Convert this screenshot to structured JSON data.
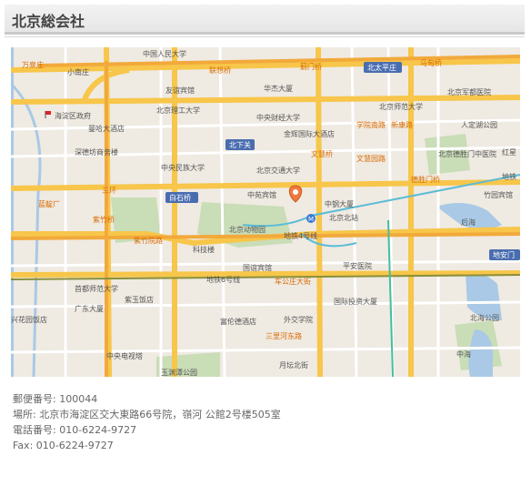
{
  "header": {
    "title": "北京総会社"
  },
  "map": {
    "labels": [
      {
        "id": "l1",
        "text": "万泉庄"
      },
      {
        "id": "l2",
        "text": "小南庄"
      },
      {
        "id": "l3",
        "text": "中国人民大学"
      },
      {
        "id": "l4",
        "text": "联想桥"
      },
      {
        "id": "l5",
        "text": "蓟门桥"
      },
      {
        "id": "l6",
        "text": "北太平庄"
      },
      {
        "id": "l7",
        "text": "马甸桥"
      },
      {
        "id": "l8",
        "text": "友谊宾馆"
      },
      {
        "id": "l9",
        "text": "华杰大厦"
      },
      {
        "id": "l10",
        "text": "北京师范大学"
      },
      {
        "id": "l11",
        "text": "北京军都医院"
      },
      {
        "id": "l12",
        "text": "海淀区政府"
      },
      {
        "id": "l13",
        "text": "北京理工大学"
      },
      {
        "id": "l14",
        "text": "中央财经大学"
      },
      {
        "id": "l15",
        "text": "学院南路"
      },
      {
        "id": "l16",
        "text": "新康路"
      },
      {
        "id": "l17",
        "text": "人定湖公园"
      },
      {
        "id": "l18",
        "text": "曼哈大酒店"
      },
      {
        "id": "l19",
        "text": "金辉国际大酒店"
      },
      {
        "id": "l20",
        "text": "北下关"
      },
      {
        "id": "l21",
        "text": "北京德胜门中医院"
      },
      {
        "id": "l22",
        "text": "深德坊商务楼"
      },
      {
        "id": "l23",
        "text": "文慧园路"
      },
      {
        "id": "l24",
        "text": "中央民族大学"
      },
      {
        "id": "l25",
        "text": "北京交通大学"
      },
      {
        "id": "l26",
        "text": "德胜门桥"
      },
      {
        "id": "l27",
        "text": "地铁"
      },
      {
        "id": "l28",
        "text": "三环"
      },
      {
        "id": "l29",
        "text": "白石桥"
      },
      {
        "id": "l30",
        "text": "中苑宾馆"
      },
      {
        "id": "l31",
        "text": "中钢大厦"
      },
      {
        "id": "l32",
        "text": "竹园宾馆"
      },
      {
        "id": "l33",
        "text": "紫竹桥"
      },
      {
        "id": "l34",
        "text": "北京动物园"
      },
      {
        "id": "l35",
        "text": "北京北站"
      },
      {
        "id": "l36",
        "text": "后海"
      },
      {
        "id": "l37",
        "text": "紫竹院路"
      },
      {
        "id": "l38",
        "text": "科技楼"
      },
      {
        "id": "l39",
        "text": "地铁4号线"
      },
      {
        "id": "l40",
        "text": "地安门"
      },
      {
        "id": "l41",
        "text": "国谊宾馆"
      },
      {
        "id": "l42",
        "text": "平安医院"
      },
      {
        "id": "l43",
        "text": "地铁6号线"
      },
      {
        "id": "l44",
        "text": "车公庄大街"
      },
      {
        "id": "l45",
        "text": "首都师范大学"
      },
      {
        "id": "l46",
        "text": "国际投资大厦"
      },
      {
        "id": "l47",
        "text": "广东大厦"
      },
      {
        "id": "l48",
        "text": "紫玉饭店"
      },
      {
        "id": "l49",
        "text": "北海公园"
      },
      {
        "id": "l50",
        "text": "兴花园饭店"
      },
      {
        "id": "l51",
        "text": "富伦德酒店"
      },
      {
        "id": "l52",
        "text": "外交学院"
      },
      {
        "id": "l53",
        "text": "中央电视塔"
      },
      {
        "id": "l54",
        "text": "三里河东路"
      },
      {
        "id": "l55",
        "text": "月坛北街"
      },
      {
        "id": "l56",
        "text": "玉渊潭公园"
      },
      {
        "id": "l57",
        "text": "中海"
      },
      {
        "id": "l58",
        "text": "蓝靛厂"
      },
      {
        "id": "l59",
        "text": "北京北站"
      },
      {
        "id": "l60",
        "text": "文慧桥"
      },
      {
        "id": "l61",
        "text": "红星"
      }
    ]
  },
  "info": {
    "postal": "郵便番号: 100044",
    "address": "場所: 北京市海淀区交大東路66号院，嶺河 公館2号楼505室",
    "phone": "電話番号: 010-6224-9727",
    "fax": "Fax: 010-6224-9727"
  }
}
